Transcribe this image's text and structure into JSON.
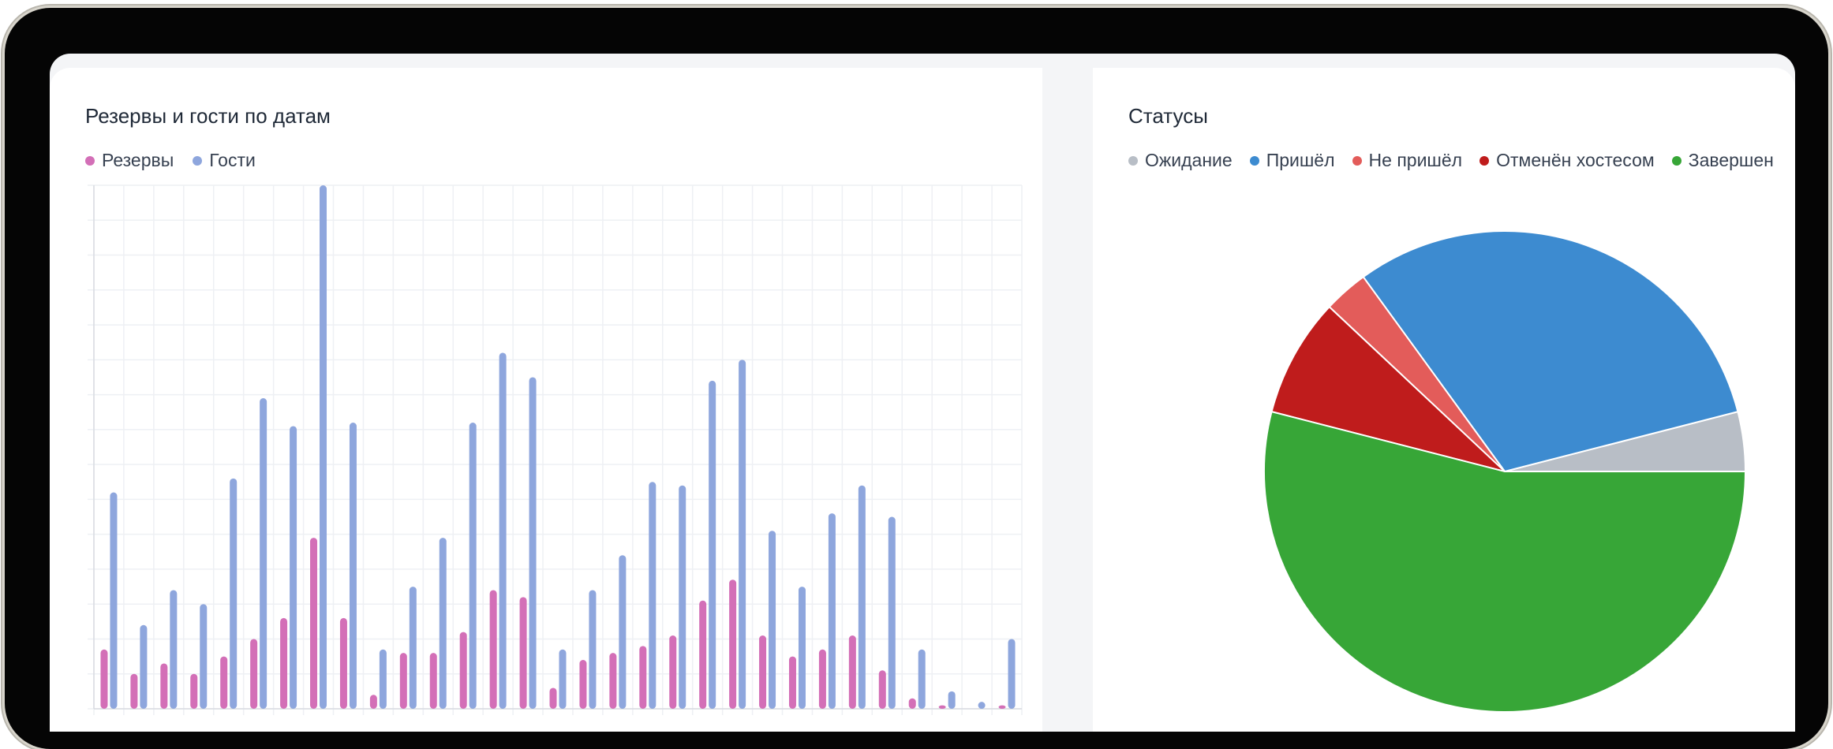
{
  "charts": {
    "bars": {
      "title": "Резервы и гости по датам"
    },
    "status": {
      "title": "Статусы"
    }
  },
  "chart_data": [
    {
      "type": "bar",
      "title": "Резервы и гости по датам",
      "series": [
        {
          "name": "Резервы",
          "color": "#d36fb7",
          "values": [
            17,
            10,
            13,
            10,
            15,
            20,
            26,
            49,
            26,
            4,
            16,
            16,
            22,
            34,
            32,
            6,
            14,
            16,
            18,
            21,
            31,
            37,
            21,
            15,
            17,
            21,
            11,
            3,
            1,
            0,
            1
          ]
        },
        {
          "name": "Гости",
          "color": "#8ea6dd",
          "values": [
            62,
            24,
            34,
            30,
            66,
            89,
            81,
            150,
            82,
            17,
            35,
            49,
            82,
            102,
            95,
            17,
            34,
            44,
            65,
            64,
            94,
            100,
            51,
            35,
            56,
            64,
            55,
            17,
            5,
            2,
            20
          ]
        }
      ],
      "ylim": [
        0,
        150
      ],
      "grid": true,
      "legend": "top-left"
    },
    {
      "type": "pie",
      "title": "Статусы",
      "slices": [
        {
          "label": "Ожидание",
          "value": 4,
          "color": "#b8bec6"
        },
        {
          "label": "Пришёл",
          "value": 31,
          "color": "#3d8bd0"
        },
        {
          "label": "Не пришёл",
          "value": 3,
          "color": "#e35c5a"
        },
        {
          "label": "Отменён хостесом",
          "value": 8,
          "color": "#bf1c1c"
        },
        {
          "label": "Завершен",
          "value": 54,
          "color": "#37a637"
        }
      ],
      "legend": "top"
    }
  ]
}
